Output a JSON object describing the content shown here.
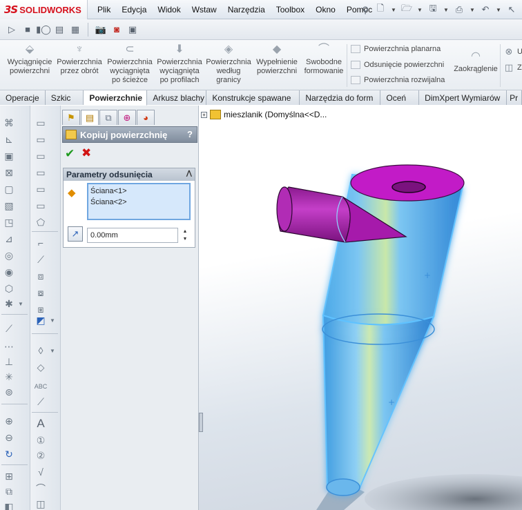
{
  "app": {
    "logo_mark": "3S",
    "logo_text": "SOLIDWORKS"
  },
  "menu": {
    "items": [
      "Plik",
      "Edycja",
      "Widok",
      "Wstaw",
      "Narzędzia",
      "Toolbox",
      "Okno",
      "Pomoc"
    ]
  },
  "command_manager": {
    "buttons": [
      {
        "label": "Wyciągnięcie\npowierzchni"
      },
      {
        "label": "Powierzchnia\nprzez obrót"
      },
      {
        "label": "Powierzchnia\nwyciągnięta\npo ścieżce"
      },
      {
        "label": "Powierzchnia\nwyciągnięta\npo profilach"
      },
      {
        "label": "Powierzchnia\nwedług\ngranicy"
      },
      {
        "label": "Wypełnienie\npowierzchni"
      },
      {
        "label": "Swobodne\nformowanie"
      }
    ],
    "small_buttons": [
      "Powierzchnia planarna",
      "Odsunięcie powierzchni",
      "Powierzchnia rozwijalna"
    ],
    "fillet": "Zaokrąglenie"
  },
  "tabs": [
    "Operacje",
    "Szkic",
    "Powierzchnie",
    "Arkusz blachy",
    "Konstrukcje spawane",
    "Narzędzia do form",
    "Oceń",
    "DimXpert Wymiarów",
    "Pr"
  ],
  "active_tab": "Powierzchnie",
  "property_manager": {
    "title": "Kopiuj powierzchnię",
    "help": "?",
    "group_title": "Parametry odsunięcia",
    "selections": [
      "Ściana<1>",
      "Ściana<2>"
    ],
    "offset_value": "0.00mm"
  },
  "feature_tree": {
    "root": "mieszlanik  (Domyślna<<D..."
  },
  "colors": {
    "accent": "#d6101c",
    "part_purple": "#b010b5",
    "glow": "#2da8ff",
    "selection_bg": "#d6e8fb"
  }
}
